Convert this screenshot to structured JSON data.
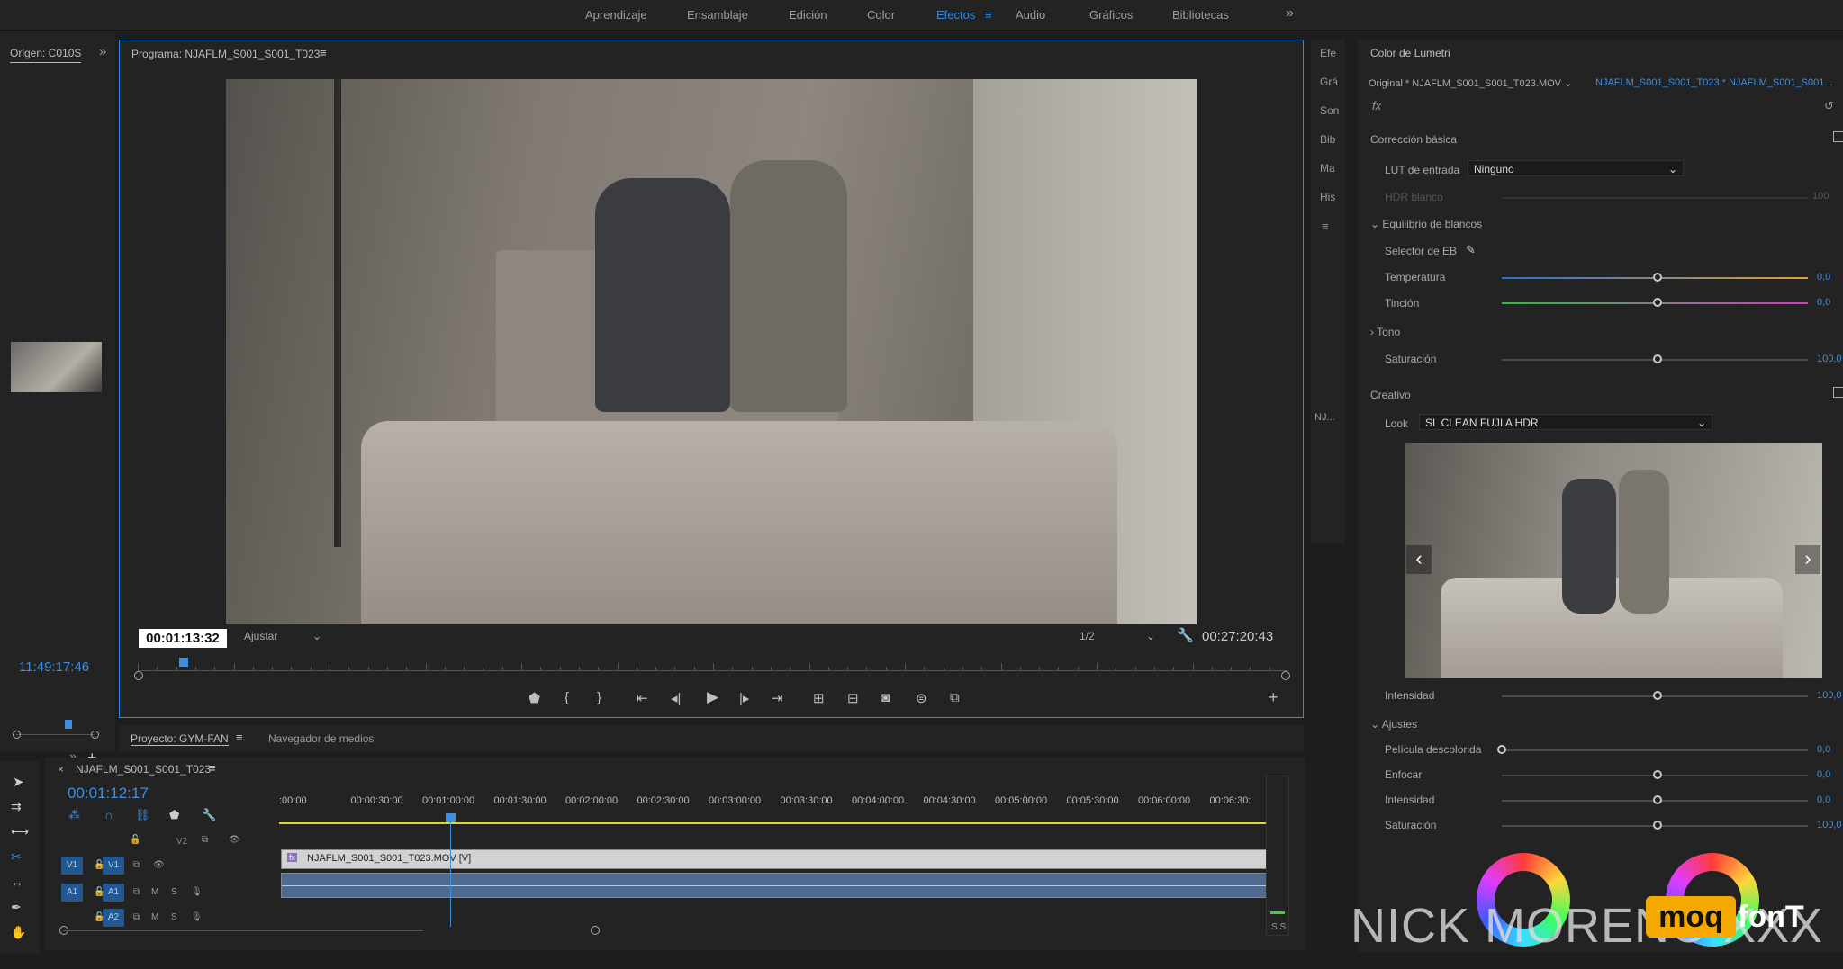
{
  "workspaces": [
    "Aprendizaje",
    "Ensamblaje",
    "Edición",
    "Color",
    "Efectos",
    "Audio",
    "Gráficos",
    "Bibliotecas"
  ],
  "active_workspace": "Efectos",
  "source_panel": {
    "tab": "Origen: C010S",
    "timecode": "11:49:17:46"
  },
  "program_monitor": {
    "title": "Programa: NJAFLM_S001_S001_T023",
    "current_timecode": "00:01:13:32",
    "fit": "Ajustar",
    "resolution": "1/2",
    "duration": "00:27:20:43",
    "playhead_fraction": 0.04
  },
  "side_tabs": [
    "Efe",
    "Grá",
    "Son",
    "Bib",
    "Ma",
    "His"
  ],
  "side_tab_lower": "NJ...",
  "lumetri": {
    "title": "Color de Lumetri",
    "source_clip": "Original * NJAFLM_S001_S001_T023.MOV",
    "target_clip": "NJAFLM_S001_S001_T023 * NJAFLM_S001_S001...",
    "fx": "fx",
    "basic_section": "Corrección básica",
    "lut_label": "LUT de entrada",
    "lut_value": "Ninguno",
    "hdr_label": "HDR blanco",
    "hdr_value": "100",
    "wb_section": "Equilibrio de blancos",
    "wb_selector": "Selector de EB",
    "temperature_label": "Temperatura",
    "temperature_value": "0,0",
    "tint_label": "Tinción",
    "tint_value": "0,0",
    "tone_section": "Tono",
    "saturation_label": "Saturación",
    "saturation_value": "100,0",
    "creative_section": "Creativo",
    "look_label": "Look",
    "look_value": "SL CLEAN FUJI A HDR",
    "intensity_label": "Intensidad",
    "intensity_value": "100,0",
    "adjust_section": "Ajustes",
    "faded_label": "Película descolorida",
    "faded_value": "0,0",
    "sharpen_label": "Enfocar",
    "sharpen_value": "0,0",
    "vibrance_label": "Intensidad",
    "vibrance_value": "0,0",
    "sat2_label": "Saturación",
    "sat2_value": "100,0"
  },
  "project_panel": {
    "tab": "Proyecto: GYM-FAN",
    "tab2": "Navegador de medios"
  },
  "timeline": {
    "sequence": "NJAFLM_S001_S001_T023",
    "timecode": "00:01:12:17",
    "ruler": [
      ":00:00",
      "00:00:30:00",
      "00:01:00:00",
      "00:01:30:00",
      "00:02:00:00",
      "00:02:30:00",
      "00:03:00:00",
      "00:03:30:00",
      "00:04:00:00",
      "00:04:30:00",
      "00:05:00:00",
      "00:05:30:00",
      "00:06:00:00",
      "00:06:30:"
    ],
    "tracks": [
      "V2",
      "V1",
      "A1",
      "A2"
    ],
    "clip_label": "NJAFLM_S001_S001_T023.MOV [V]",
    "clip_fx": "fx",
    "meter_label": "S S"
  },
  "watermark": {
    "text": "NICK MORENO XXX",
    "badge": "moq",
    "badge2": "fonT"
  }
}
